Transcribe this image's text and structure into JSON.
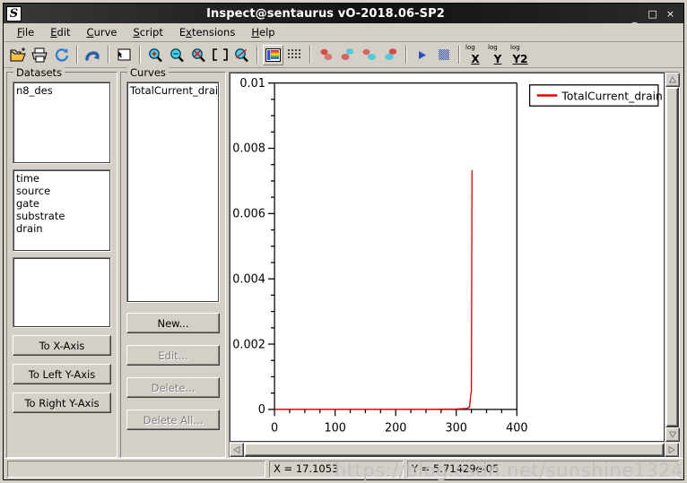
{
  "window": {
    "title": "Inspect@sentaurus vO-2018.06-SP2",
    "icon": "sentaurus-s-logo",
    "minimize_label": "_",
    "maximize_label": "□",
    "close_label": "×"
  },
  "menubar": {
    "items": [
      {
        "label": "File",
        "mnemonic": "F"
      },
      {
        "label": "Edit",
        "mnemonic": "E"
      },
      {
        "label": "Curve",
        "mnemonic": "C"
      },
      {
        "label": "Script",
        "mnemonic": "S"
      },
      {
        "label": "Extensions",
        "mnemonic": "x"
      },
      {
        "label": "Help",
        "mnemonic": "H"
      }
    ]
  },
  "toolbar": {
    "items": [
      {
        "name": "open-file-icon",
        "tip": "Open"
      },
      {
        "name": "print-icon",
        "tip": "Print"
      },
      {
        "name": "reload-icon",
        "tip": "Reload"
      },
      {
        "name": "undo-icon",
        "tip": "Undo"
      },
      {
        "name": "select-area-icon",
        "tip": "Select"
      },
      {
        "name": "zoom-in-icon",
        "tip": "Zoom In"
      },
      {
        "name": "zoom-out-icon",
        "tip": "Zoom Out"
      },
      {
        "name": "zoom-reset-icon",
        "tip": "Unzoom"
      },
      {
        "name": "zoom-fit-icon",
        "tip": "Fit"
      },
      {
        "name": "zoom-select-icon",
        "tip": "Zoom Select"
      },
      {
        "name": "color-palette-icon",
        "tip": "Colors"
      },
      {
        "name": "grid-icon",
        "tip": "Grid"
      },
      {
        "name": "curve-red-icon",
        "tip": "Curve 1"
      },
      {
        "name": "curve-cyan-icon",
        "tip": "Curve 2"
      },
      {
        "name": "curve-cyan2-icon",
        "tip": "Curve 3"
      },
      {
        "name": "curve-red2-icon",
        "tip": "Curve 4"
      },
      {
        "name": "play-icon",
        "tip": "Run"
      },
      {
        "name": "dither-icon",
        "tip": "Pattern"
      }
    ],
    "log_buttons": [
      {
        "sup": "log",
        "axis": "X",
        "name": "log-x-button"
      },
      {
        "sup": "log",
        "axis": "Y",
        "name": "log-y-button"
      },
      {
        "sup": "log",
        "axis": "Y2",
        "name": "log-y2-button"
      }
    ]
  },
  "datasets_panel": {
    "title": "Datasets",
    "files": [
      "n8_des"
    ],
    "fields": [
      "time",
      "source",
      "gate",
      "substrate",
      "drain"
    ],
    "extra": [],
    "buttons": [
      {
        "label": "To X-Axis",
        "name": "to-x-axis-button",
        "disabled": false
      },
      {
        "label": "To Left Y-Axis",
        "name": "to-left-y-axis-button",
        "disabled": false
      },
      {
        "label": "To Right Y-Axis",
        "name": "to-right-y-axis-button",
        "disabled": false
      }
    ]
  },
  "curves_panel": {
    "title": "Curves",
    "curves": [
      "TotalCurrent_drain"
    ],
    "buttons": [
      {
        "label": "New...",
        "name": "new-curve-button",
        "disabled": false
      },
      {
        "label": "Edit...",
        "name": "edit-curve-button",
        "disabled": true
      },
      {
        "label": "Delete...",
        "name": "delete-curve-button",
        "disabled": true
      },
      {
        "label": "Delete All...",
        "name": "delete-all-curves-button",
        "disabled": true
      }
    ]
  },
  "statusbar": {
    "blank": "",
    "x_readout": "X = 17.1053",
    "y_readout": "Y = 5.71429e-05"
  },
  "watermark": "https://blog.csdn.net/sunshine1324",
  "colors": {
    "curve": "#e00000",
    "axis": "#000000",
    "plot_background": "#ffffff",
    "window_face": "#d4d0c8",
    "titlebar": "#111111"
  },
  "chart_data": {
    "type": "line",
    "title": "",
    "xlabel": "",
    "ylabel": "",
    "xlim": [
      0,
      400
    ],
    "ylim": [
      0,
      0.01
    ],
    "xticks": [
      0,
      100,
      200,
      300,
      400
    ],
    "xtick_labels": [
      "0",
      "100",
      "200",
      "300",
      "400"
    ],
    "x_minor_ticks": [
      25,
      50,
      75,
      125,
      150,
      175,
      225,
      250,
      275,
      325,
      350,
      375
    ],
    "yticks": [
      0,
      0.002,
      0.004,
      0.006,
      0.008,
      0.01
    ],
    "ytick_labels": [
      "0",
      "0.002",
      "0.004",
      "0.006",
      "0.008",
      "0.01"
    ],
    "y_minor_ticks": [
      0.0005,
      0.001,
      0.0015,
      0.0025,
      0.003,
      0.0035,
      0.0045,
      0.005,
      0.0055,
      0.0065,
      0.007,
      0.0075,
      0.0085,
      0.009,
      0.0095
    ],
    "grid": false,
    "legend_position": "top-right",
    "series": [
      {
        "name": "TotalCurrent_drain",
        "color": "#e00000",
        "x": [
          0,
          50,
          100,
          150,
          200,
          250,
          300,
          318,
          322,
          324,
          325,
          325.5,
          326
        ],
        "values": [
          0.0,
          0.0,
          0.0,
          0.0,
          0.0,
          0.0,
          1e-05,
          3e-05,
          8e-05,
          0.00045,
          0.00055,
          0.004,
          0.00733
        ]
      }
    ]
  }
}
